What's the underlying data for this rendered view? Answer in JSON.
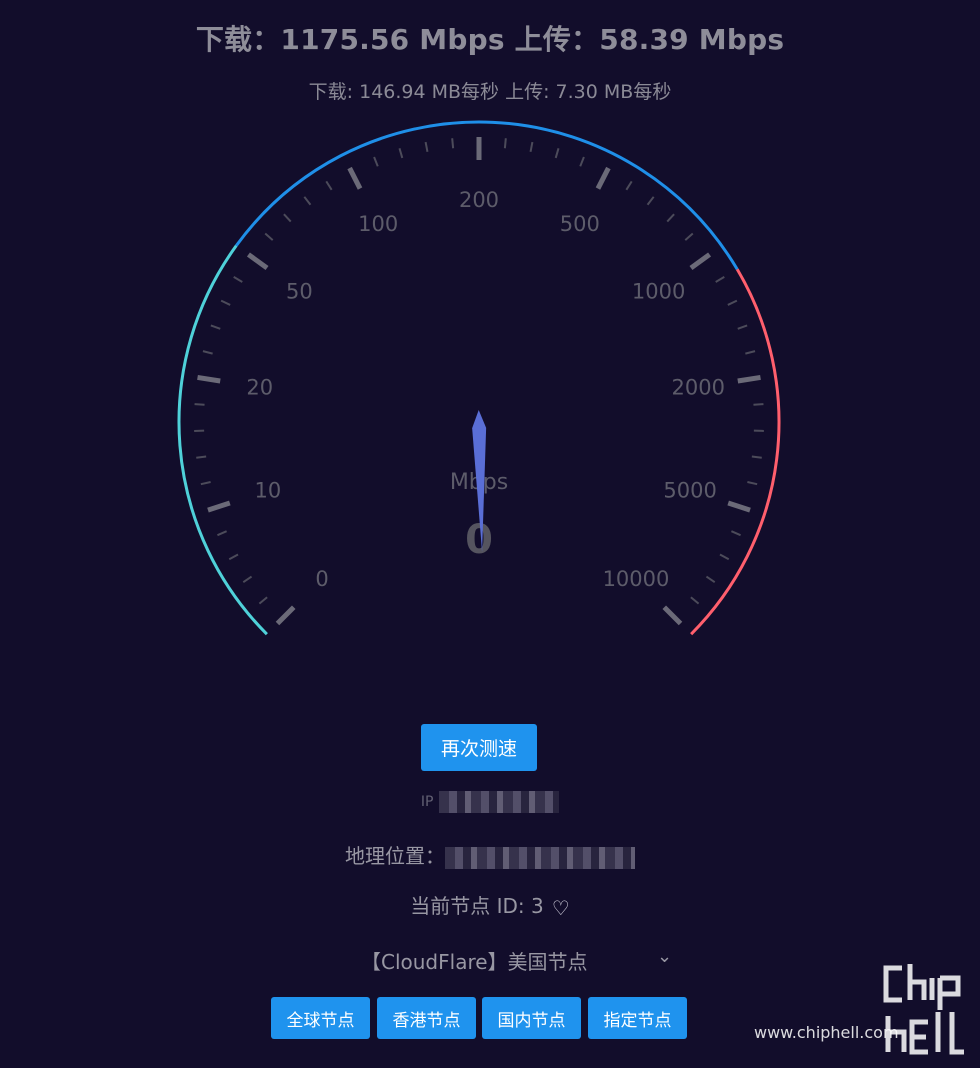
{
  "header": {
    "headline": "下载：1175.56 Mbps 上传：58.39 Mbps",
    "subline": "下载: 146.94 MB每秒 上传: 7.30 MB每秒"
  },
  "gauge": {
    "unit": "Mbps",
    "value": "0",
    "tick_labels": [
      "0",
      "10",
      "20",
      "50",
      "100",
      "200",
      "500",
      "1000",
      "2000",
      "5000",
      "10000"
    ],
    "needle_position_fraction": 0.495,
    "colors": {
      "low": "#4fd1d9",
      "mid": "#1f8fe8",
      "high": "#ff5f6d",
      "needle": "#5a6ed6"
    }
  },
  "actions": {
    "retest_label": "再次测速"
  },
  "info": {
    "ip_label": "IP",
    "geo_label": "地理位置：",
    "node_id_text": "当前节点 ID: 3"
  },
  "node_select": {
    "selected": "【CloudFlare】美国节点"
  },
  "node_buttons": [
    "全球节点",
    "香港节点",
    "国内节点",
    "指定节点"
  ],
  "watermark": {
    "url": "www.chiphell.com",
    "logo_text": "chiphell"
  }
}
